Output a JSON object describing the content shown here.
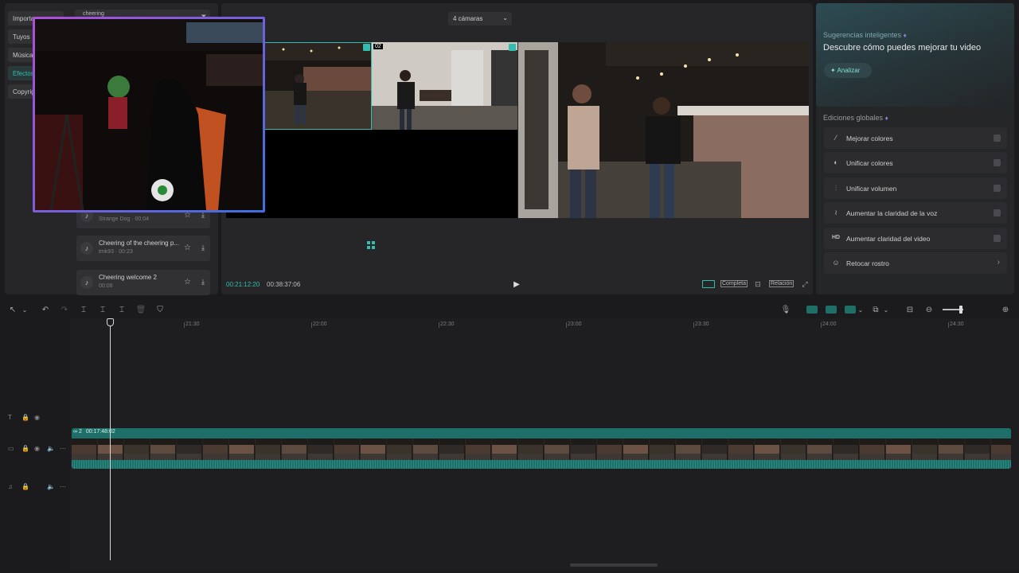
{
  "left_tabs": [
    "Importar",
    "Tuyos",
    "Música",
    "Efectos",
    "Copyright"
  ],
  "search": {
    "value": "cheering"
  },
  "music_items": [
    {
      "title": "",
      "meta": "Strange Dog · 00:04"
    },
    {
      "title": "Cheering of the cheering p...",
      "meta": "tmk93 · 00:23"
    },
    {
      "title": "Cheering welcome 2",
      "meta": "00:08"
    }
  ],
  "player": {
    "camera_select": "4 cámaras",
    "cam2_badge": "02",
    "current_time": "00:21:12:20",
    "total_time": "00:38:37:06",
    "full_label": "Completa",
    "ratio_label": "Relación"
  },
  "smart": {
    "heading": "Sugerencias inteligentes",
    "title": "Descubre cómo puedes mejorar tu video",
    "analyze_label": "Analizar"
  },
  "global_edits": {
    "heading": "Ediciones globales",
    "items": [
      {
        "label": "Mejorar colores",
        "icon": "magic-wand-icon"
      },
      {
        "label": "Unificar colores",
        "icon": "palette-icon"
      },
      {
        "label": "Unificar volumen",
        "icon": "equalizer-icon"
      },
      {
        "label": "Aumentar la claridad de la voz",
        "icon": "voice-icon"
      },
      {
        "label": "Aumentar claridad del video",
        "icon": "hd-icon"
      },
      {
        "label": "Retocar rostro",
        "icon": "face-icon"
      }
    ],
    "hd_text": "HD"
  },
  "timeline": {
    "ruler": [
      "21:30",
      "22:00",
      "22:30",
      "23:00",
      "23:30",
      "24:00",
      "24:30"
    ],
    "clip_name": "2",
    "clip_duration": "00:17:48:02"
  },
  "colors": {
    "accent": "#33bdb0",
    "clip_teal": "#1f6f69",
    "pip_gradient_start": "#b04fd6",
    "pip_gradient_end": "#3d6fe0"
  }
}
